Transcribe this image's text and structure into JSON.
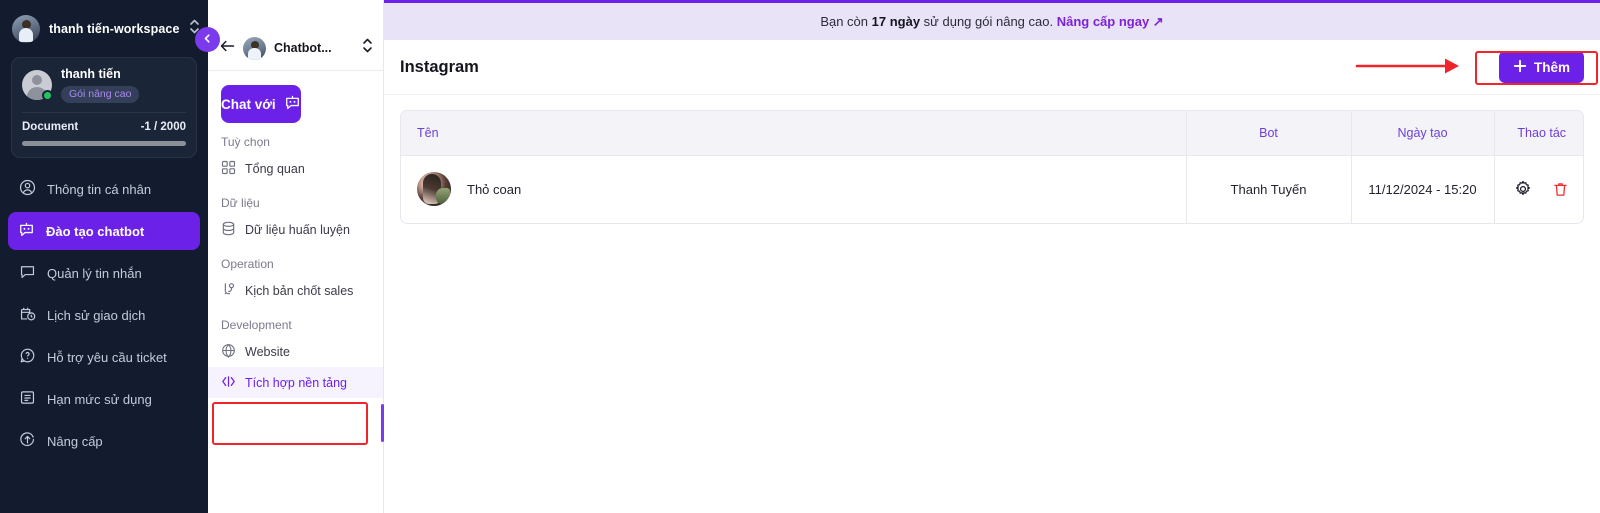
{
  "sidebar": {
    "workspace_name": "thanh tiến-workspace",
    "sort_icon": "sort-vertical-icon",
    "plan": {
      "user_name": "thanh tiến",
      "badge": "Gói nâng cao",
      "doc_label": "Document",
      "doc_count": "-1 / 2000"
    },
    "items": [
      {
        "label": "Thông tin cá nhân",
        "icon": "user-circle-icon",
        "active": false
      },
      {
        "label": "Đào tạo chatbot",
        "icon": "robot-icon",
        "active": true
      },
      {
        "label": "Quản lý tin nhắn",
        "icon": "message-icon",
        "active": false
      },
      {
        "label": "Lịch sử giao dịch",
        "icon": "calendar-clock-icon",
        "active": false
      },
      {
        "label": "Hỗ trợ yêu cầu ticket",
        "icon": "question-chat-icon",
        "active": false
      },
      {
        "label": "Hạn mức sử dụng",
        "icon": "list-box-icon",
        "active": false
      },
      {
        "label": "Nâng cấp",
        "icon": "upgrade-arrow-icon",
        "active": false
      }
    ],
    "collapse_icon": "chevron-left-icon"
  },
  "panel2": {
    "back_icon": "arrow-left-icon",
    "bot_name": "Chatbot...",
    "sort_icon": "sort-vertical-icon",
    "chat_button": "Chat với",
    "chat_button_icon": "robot-icon",
    "groups": [
      {
        "label": "Tuỳ chọn",
        "items": [
          {
            "label": "Tổng quan",
            "icon": "grid-icon",
            "selected": false
          }
        ]
      },
      {
        "label": "Dữ liệu",
        "items": [
          {
            "label": "Dữ liệu huấn luyện",
            "icon": "database-icon",
            "selected": false
          }
        ]
      },
      {
        "label": "Operation",
        "items": [
          {
            "label": "Kịch bản chốt sales",
            "icon": "flow-branch-icon",
            "selected": false
          }
        ]
      },
      {
        "label": "Development",
        "items": [
          {
            "label": "Website",
            "icon": "globe-icon",
            "selected": false
          },
          {
            "label": "Tích hợp nền tảng",
            "icon": "code-brackets-icon",
            "selected": true
          }
        ]
      }
    ]
  },
  "topbar": {
    "prefix": "Bạn còn ",
    "days": "17 ngày",
    "middle": " sử dụng gói nâng cao. ",
    "link": "Nâng cấp ngay ↗"
  },
  "main": {
    "page_title": "Instagram",
    "add_button": "Thêm",
    "add_button_icon": "plus-icon",
    "table": {
      "columns": [
        "Tên",
        "Bot",
        "Ngày tạo",
        "Thao tác"
      ],
      "rows": [
        {
          "name": "Thỏ coan",
          "avatar": "user-photo-avatar",
          "bot": "Thanh Tuyến",
          "created": "11/12/2024 - 15:20",
          "actions": [
            "gear-icon",
            "trash-icon"
          ]
        }
      ]
    }
  },
  "annotations": {
    "accent_red": "#f0242c",
    "brand_purple": "#6b21e8"
  }
}
